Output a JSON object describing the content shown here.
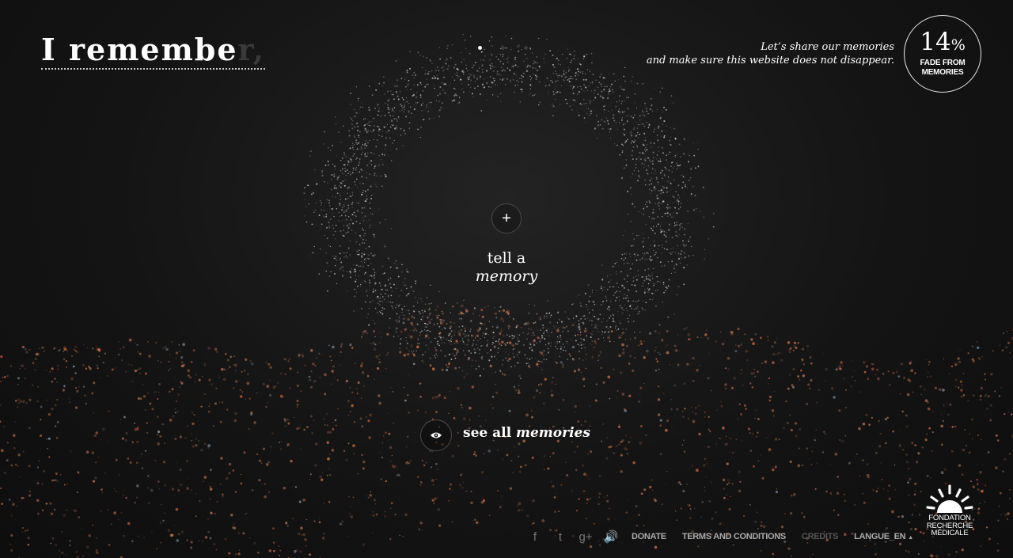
{
  "header": {
    "logo_main": "I remembe",
    "logo_faded": "r,",
    "tagline_line1": "Let’s share our memories",
    "tagline_line2": "and make sure this website does not disappear.",
    "fade_percent": "14",
    "fade_percent_symbol": "%",
    "fade_label_line1": "FADE FROM",
    "fade_label_line2": "MEMORIES",
    "pager_active_index": 0,
    "pager_count": 3
  },
  "hero": {
    "add_icon": "plus-icon",
    "add_symbol": "+",
    "tell_line1": "tell a",
    "tell_line2": "memory"
  },
  "see_all": {
    "icon": "eye-icon",
    "prefix": "see all",
    "emphasis": "memories"
  },
  "footer": {
    "social": [
      {
        "name": "facebook-icon",
        "glyph": "f"
      },
      {
        "name": "twitter-icon",
        "glyph": "t"
      },
      {
        "name": "google-plus-icon",
        "glyph": "g+"
      },
      {
        "name": "sound-icon",
        "glyph": "🔊"
      }
    ],
    "donate": "DONATE",
    "terms": "TERMS AND CONDITIONS",
    "credits": "CREDITS",
    "language": "LANGUE_EN",
    "caret": "▲"
  },
  "partner": {
    "line1": "FONDATION",
    "line2": "RECHERCHE",
    "line3": "MÉDICALE"
  },
  "colors": {
    "background": "#141414",
    "particle_ring": "#d0d0d0",
    "particle_ground": "#e07a4a",
    "text": "#ffffff",
    "footer_link": "#aaaaaa"
  }
}
